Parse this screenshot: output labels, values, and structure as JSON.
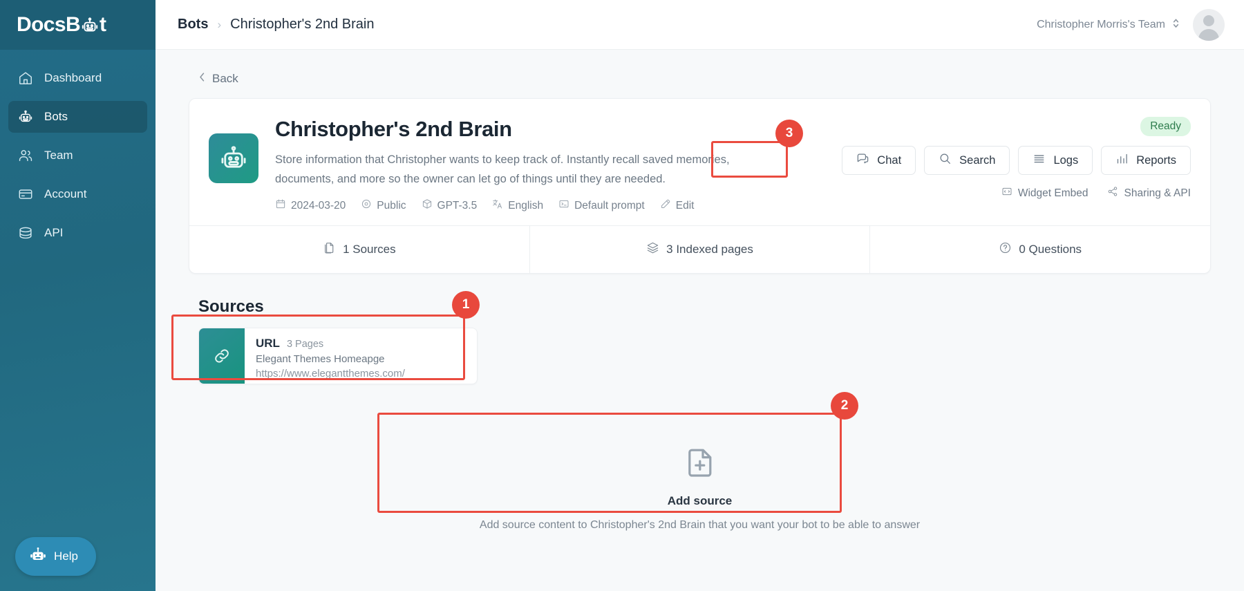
{
  "sidebar": {
    "logo": {
      "text_before": "Docs",
      "text_mid": "B",
      "text_after": "t",
      "full": "DocsBot"
    },
    "items": [
      {
        "label": "Dashboard",
        "icon": "home-icon",
        "active": false
      },
      {
        "label": "Bots",
        "icon": "robot-icon",
        "active": true
      },
      {
        "label": "Team",
        "icon": "users-icon",
        "active": false
      },
      {
        "label": "Account",
        "icon": "credit-card-icon",
        "active": false
      },
      {
        "label": "API",
        "icon": "database-icon",
        "active": false
      }
    ],
    "help_label": "Help"
  },
  "topbar": {
    "breadcrumb_root": "Bots",
    "breadcrumb_sep": "›",
    "breadcrumb_current": "Christopher's 2nd Brain",
    "team_name": "Christopher Morris's Team"
  },
  "page": {
    "back_label": "Back"
  },
  "bot": {
    "name": "Christopher's 2nd Brain",
    "description": "Store information that Christopher wants to keep track of. Instantly recall saved memories, documents, and more so the owner can let go of things until they are needed.",
    "status": "Ready",
    "meta": [
      {
        "label": "2024-03-20",
        "icon": "calendar-icon"
      },
      {
        "label": "Public",
        "icon": "eye-icon"
      },
      {
        "label": "GPT-3.5",
        "icon": "cube-icon"
      },
      {
        "label": "English",
        "icon": "translate-icon"
      },
      {
        "label": "Default prompt",
        "icon": "prompt-icon"
      },
      {
        "label": "Edit",
        "icon": "pencil-icon"
      }
    ],
    "actions": [
      {
        "label": "Chat",
        "icon": "chat-icon"
      },
      {
        "label": "Search",
        "icon": "search-icon"
      },
      {
        "label": "Logs",
        "icon": "logs-icon"
      },
      {
        "label": "Reports",
        "icon": "reports-icon"
      }
    ],
    "share_links": [
      {
        "label": "Widget Embed",
        "icon": "widget-embed-icon"
      },
      {
        "label": "Sharing & API",
        "icon": "share-icon"
      }
    ],
    "stats": [
      {
        "label": "1 Sources",
        "icon": "document-icon"
      },
      {
        "label": "3 Indexed pages",
        "icon": "layers-icon"
      },
      {
        "label": "0 Questions",
        "icon": "question-icon"
      }
    ]
  },
  "sources": {
    "heading": "Sources",
    "items": [
      {
        "type": "URL",
        "pages": "3 Pages",
        "name": "Elegant Themes Homeapge",
        "url": "https://www.elegantthemes.com/",
        "icon": "link-icon"
      }
    ]
  },
  "add_source": {
    "title": "Add source",
    "subtitle": "Add source content to Christopher's 2nd Brain that you want your bot to be able to answer",
    "icon": "document-plus-icon"
  },
  "annotations": [
    {
      "number": "1",
      "target": "source-card"
    },
    {
      "number": "2",
      "target": "add-source-panel"
    },
    {
      "number": "3",
      "target": "chat-button"
    }
  ],
  "colors": {
    "sidebar_bg": "#21687f",
    "sidebar_header_bg": "#1d5e75",
    "accent_red": "#e8483c",
    "status_bg": "#dcf6e3",
    "status_text": "#2f7d4e",
    "bot_avatar_gradient_from": "#2e8c99",
    "bot_avatar_gradient_to": "#1f9b84",
    "help_btn_bg": "#2d8cb5",
    "page_bg": "#f7f9fa"
  }
}
